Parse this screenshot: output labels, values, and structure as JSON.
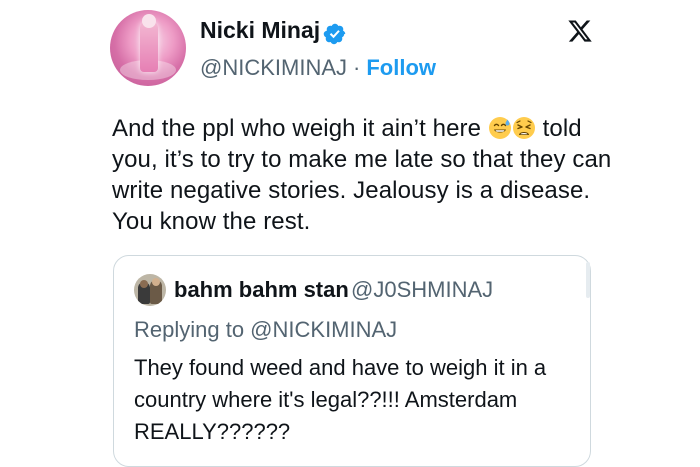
{
  "author": {
    "name": "Nicki Minaj",
    "handle": "@NICKIMINAJ",
    "separator": "·",
    "follow_label": "Follow",
    "verified_color": "#1d9bf0"
  },
  "brand": {
    "logo_icon": "x-logo-icon"
  },
  "tweet": {
    "lines": [
      {
        "before": "And the ppl who weigh it ain’t here",
        "emojis": [
          "sweat-smile-emoji",
          "weary-face-emoji"
        ],
        "after": "told"
      },
      "you, it’s to try to make me late so that they can",
      "write negative stories. Jealousy is a disease.",
      "You know the rest."
    ]
  },
  "quoted_tweet": {
    "author_name": "bahm bahm stan",
    "author_handle": "@J0SHMINAJ",
    "replying_to": "Replying to @NICKIMINAJ",
    "lines": [
      "They found weed and have to weigh it in a",
      "country where it's legal??!!! Amsterdam",
      "REALLY??????"
    ]
  }
}
